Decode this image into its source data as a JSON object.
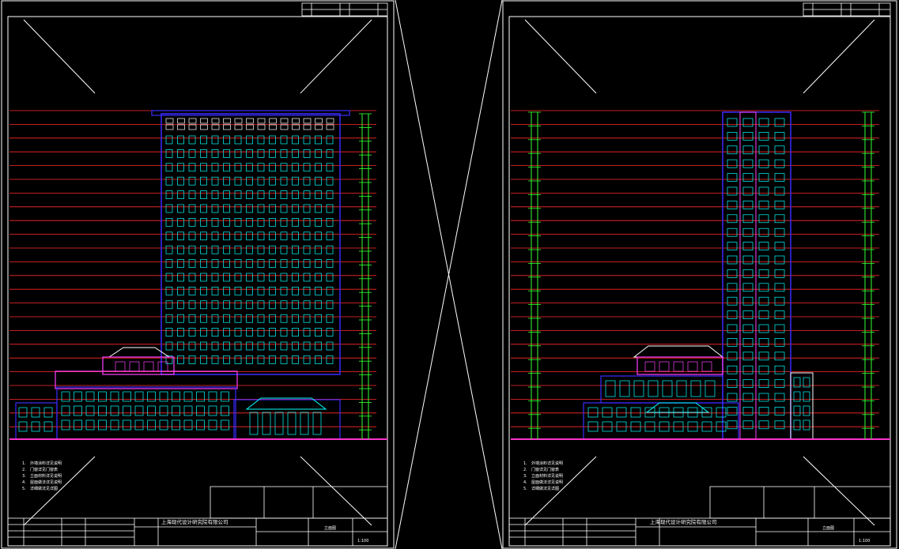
{
  "drawing": {
    "colors": {
      "background": "#000000",
      "frame": "#ffffff",
      "levels": "#ff2a2a",
      "outline": "#3a2bff",
      "windows": "#00ffff",
      "accent": "#ff40ff",
      "ground": "#ff33cc",
      "dims": "#33ff33",
      "text": "#ffffff"
    },
    "left_sheet": {
      "company": "上海现代设计研究院有限公司",
      "notes": [
        {
          "num": "1.",
          "text": "外墙涂料详见说明"
        },
        {
          "num": "2.",
          "text": "门窗详见门窗表"
        },
        {
          "num": "3.",
          "text": "立面材料详见说明"
        },
        {
          "num": "4.",
          "text": "屋面做法详见说明"
        },
        {
          "num": "5.",
          "text": "详细做法见详图"
        }
      ],
      "drawing_title": "立面图",
      "scale": "1:100"
    },
    "right_sheet": {
      "company": "上海现代设计研究院有限公司",
      "notes": [
        {
          "num": "1.",
          "text": "外墙涂料详见说明"
        },
        {
          "num": "2.",
          "text": "门窗详见门窗表"
        },
        {
          "num": "3.",
          "text": "立面材料详见说明"
        },
        {
          "num": "4.",
          "text": "屋面做法详见说明"
        },
        {
          "num": "5.",
          "text": "详细做法见详图"
        }
      ],
      "drawing_title": "立面图",
      "scale": "1:100"
    }
  }
}
